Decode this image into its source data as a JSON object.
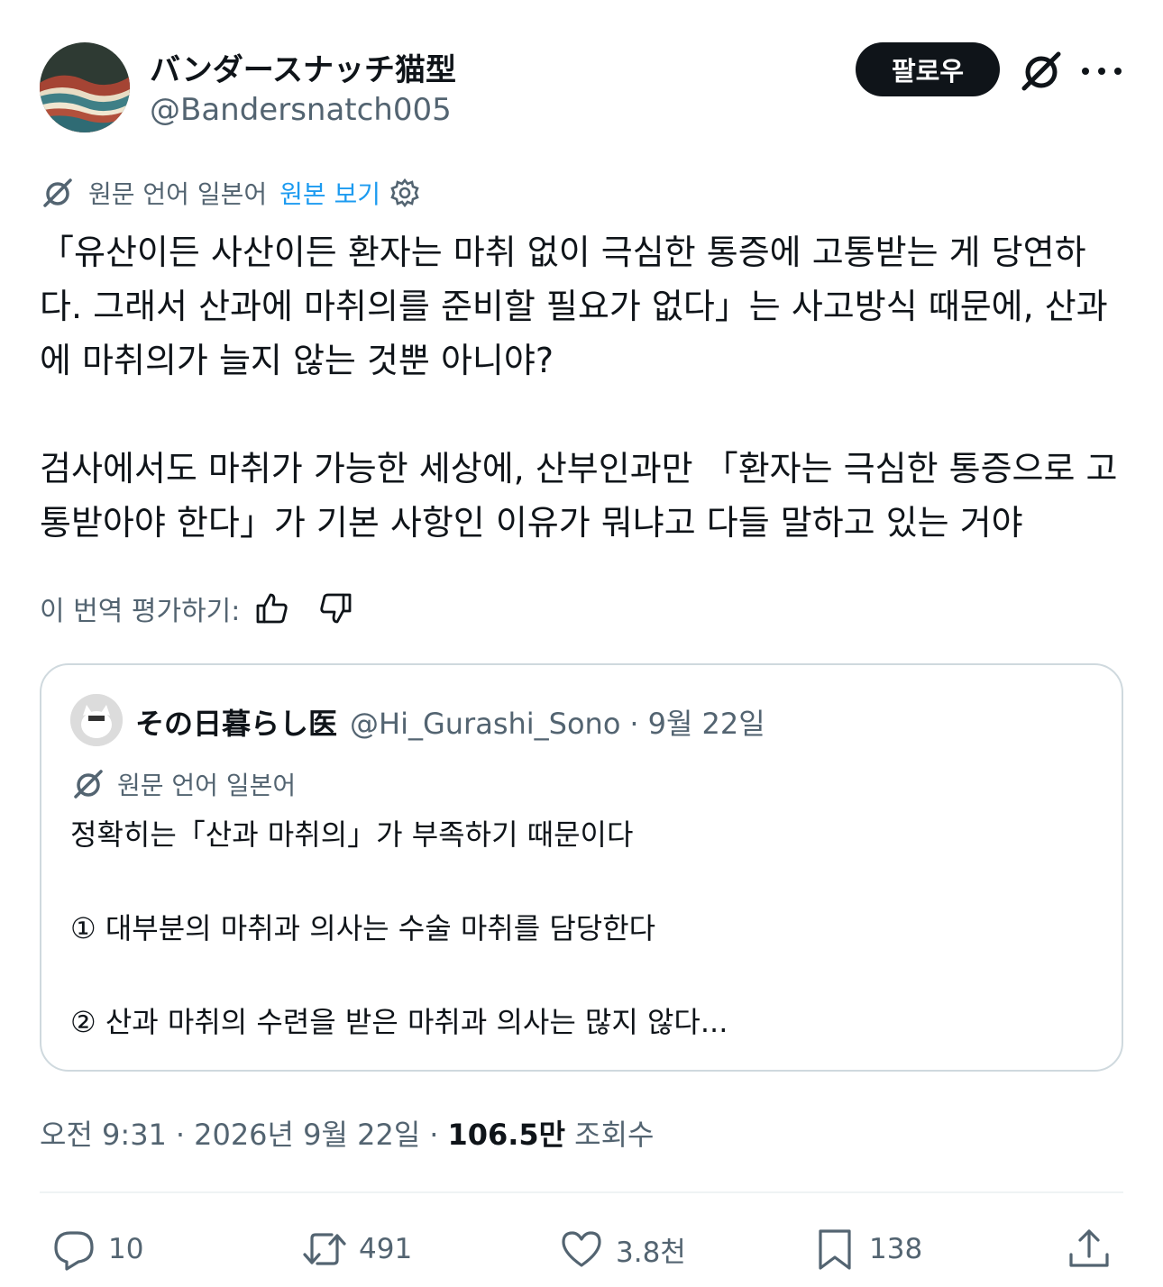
{
  "author": {
    "display_name": "バンダースナッチ猫型",
    "handle": "@Bandersnatch005",
    "avatar_icon": "wave-landscape-avatar"
  },
  "header": {
    "follow_label": "팔로우",
    "grok_icon": "grok-icon",
    "more_icon": "more-dots-icon"
  },
  "translation": {
    "source_language": "원문 언어 일본어",
    "view_original": "원본 보기",
    "settings_icon": "gear-icon"
  },
  "tweet": {
    "paragraphs": [
      "「유산이든 사산이든 환자는 마취 없이 극심한 통증에 고통받는 게 당연하다. 그래서 산과에 마취의를 준비할 필요가 없다」는 사고방식 때문에, 산과에 마취의가 늘지 않는 것뿐 아니야?",
      "검사에서도 마취가 가능한 세상에, 산부인과만 「환자는 극심한 통증으로 고통받아야 한다」가 기본 사항인 이유가 뭐냐고 다들 말하고 있는 거야"
    ],
    "rate_label": "이 번역 평가하기:"
  },
  "quote": {
    "name": "その日暮らし医",
    "handle": "@Hi_Gurashi_Sono",
    "separator": "·",
    "date": "9월 22일",
    "source_language": "원문 언어 일본어",
    "lines": [
      "정확히는「산과 마취의」가 부족하기 때문이다",
      "① 대부분의 마취과 의사는 수술 마취를 담당한다",
      "② 산과 마취의 수련을 받은 마취과 의사는 많지 않다..."
    ]
  },
  "meta": {
    "time": "오전 9:31",
    "separator": "·",
    "date": "2026년 9월 22일",
    "views_count": "106.5만",
    "views_label": "조회수"
  },
  "actions": {
    "replies": "10",
    "reposts": "491",
    "likes": "3.8천",
    "bookmarks": "138"
  },
  "colors": {
    "text_primary": "#0f1419",
    "text_secondary": "#536471",
    "link": "#1d9bf0",
    "border": "#cfd9de"
  }
}
